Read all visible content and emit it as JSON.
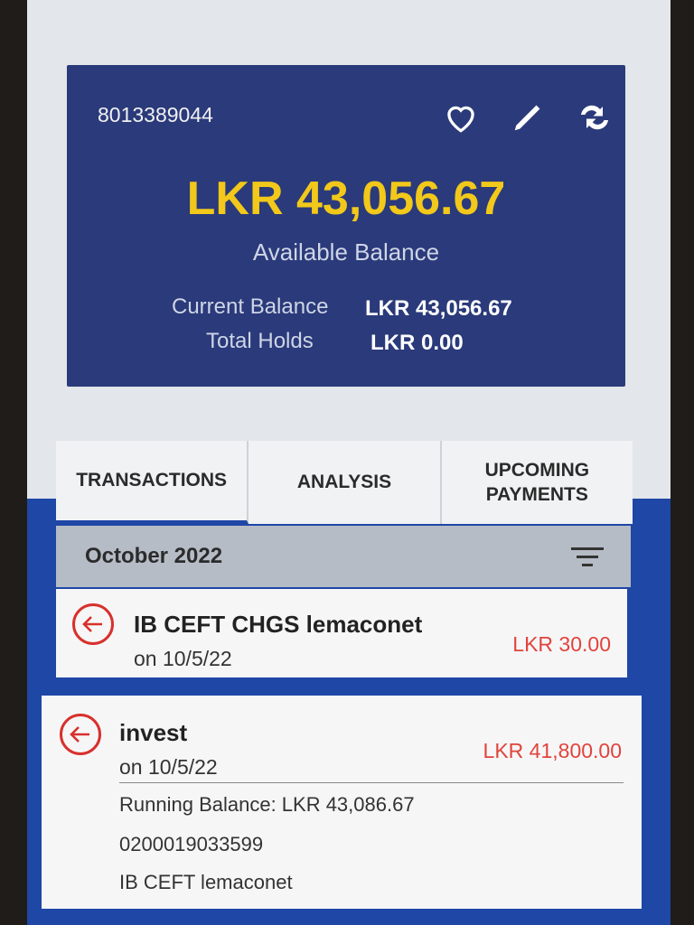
{
  "account": {
    "number": "8013389044",
    "available_balance": "LKR 43,056.67",
    "available_label": "Available Balance",
    "current_label": "Current Balance",
    "current_value": "LKR 43,056.67",
    "holds_label": "Total Holds",
    "holds_value": "LKR 0.00",
    "icons": [
      "heart-icon",
      "pencil-icon",
      "swap-icon"
    ]
  },
  "tabs": [
    {
      "label": "TRANSACTIONS",
      "active": true
    },
    {
      "label": "ANALYSIS",
      "active": false
    },
    {
      "label_line1": "UPCOMING",
      "label_line2": "PAYMENTS",
      "active": false
    }
  ],
  "month": "October 2022",
  "transactions": [
    {
      "title": "IB CEFT CHGS lemaconet",
      "date": "on 10/5/22",
      "amount": "LKR 30.00"
    },
    {
      "title": "invest",
      "date": "on 10/5/22",
      "amount": "LKR 41,800.00",
      "running_balance": "Running Balance: LKR 43,086.67",
      "reference": "0200019033599",
      "description": "IB CEFT lemaconet"
    }
  ],
  "colors": {
    "card_bg": "#2a3a7a",
    "balance": "#f2c81a",
    "accent_blue": "#1e47a6",
    "debit_red": "#e0443c"
  }
}
